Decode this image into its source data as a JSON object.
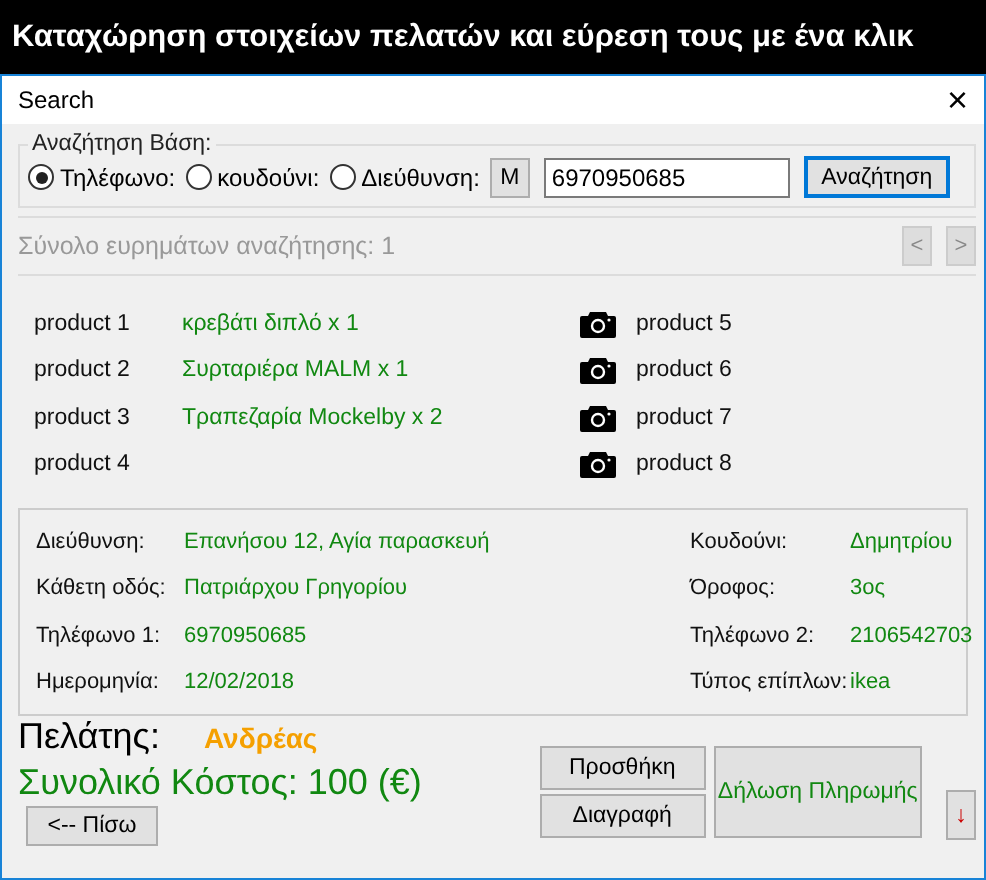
{
  "banner": {
    "title": "Καταχώρηση στοιχείων πελατών και εύρεση τους με ένα κλικ"
  },
  "window": {
    "title": "Search",
    "close": "×"
  },
  "search": {
    "legend": "Αναζήτηση Βάση:",
    "options": [
      {
        "label": "Τηλέφωνο:",
        "selected": true
      },
      {
        "label": "κουδούνι:",
        "selected": false
      },
      {
        "label": "Διεύθυνση:",
        "selected": false
      }
    ],
    "m_button": "M",
    "value": "6970950685",
    "button": "Αναζήτηση"
  },
  "results": {
    "text": "Σύνολο ευρημάτων αναζήτησης: 1",
    "prev": "<",
    "next": ">",
    "nav_disabled": true
  },
  "products": [
    {
      "label": "product 1",
      "item": "κρεβάτι διπλό  x 1",
      "right": "product 5"
    },
    {
      "label": "product 2",
      "item": "Συρταριέρα MALM x 1",
      "right": "product 6"
    },
    {
      "label": "product 3",
      "item": "Τραπεζαρία Mockelby x 2",
      "right": "product 7"
    },
    {
      "label": "product 4",
      "right": "product 8"
    }
  ],
  "details": [
    {
      "label": "Διεύθυνση:",
      "value": "Επανήσου 12, Αγία παρασκευή",
      "label_2": "Κουδούνι:",
      "value_2": "Δημητρίου"
    },
    {
      "label": "Κάθετη οδός:",
      "value": "Πατριάρχου Γρηγορίου",
      "label_2": "Όροφος:",
      "value_2": "3ος"
    },
    {
      "label": "Τηλέφωνο 1:",
      "value": "6970950685",
      "label_2": "Τηλέφωνο 2:",
      "value_2": "2106542703"
    },
    {
      "label": "Ημερομηνία:",
      "value": "12/02/2018",
      "label_2": "Τύπος επίπλων:",
      "value_2": "ikea"
    }
  ],
  "customer": {
    "label": "Πελάτης:",
    "name": "Ανδρέας"
  },
  "total": "Συνολικό Κόστος: 100 (€)",
  "buttons": {
    "back": "<--   Πίσω",
    "add": "Προσθήκη",
    "delete": "Διαγραφή",
    "payment": "Δήλωση Πληρωμής",
    "down": "↓"
  }
}
